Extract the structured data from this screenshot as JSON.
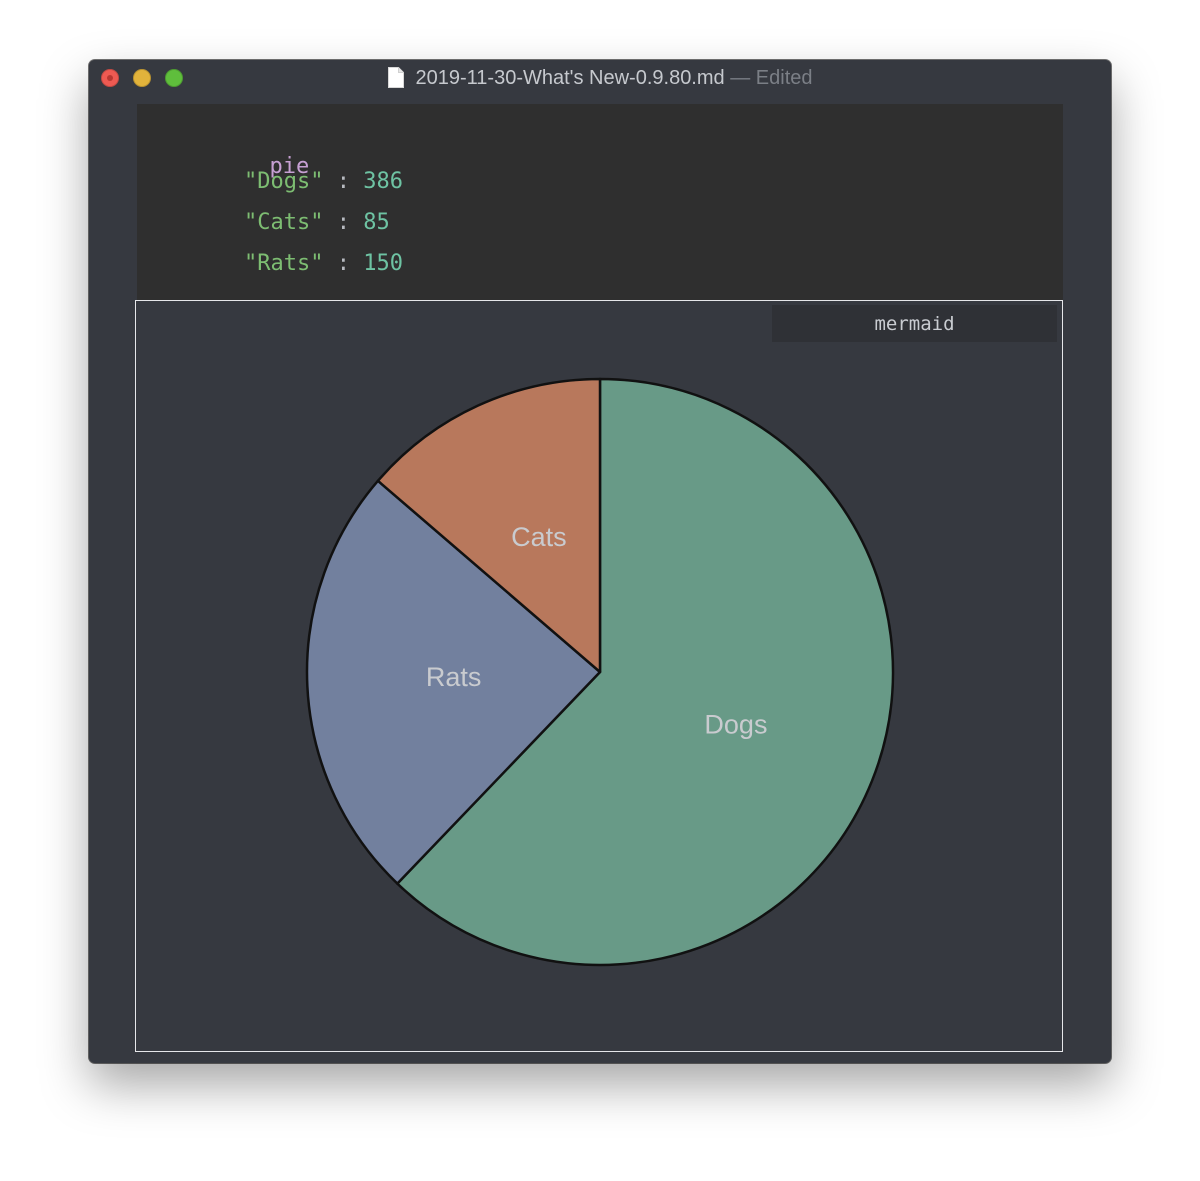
{
  "window": {
    "title": "2019-11-30-What's New-0.9.80.md",
    "separator": "—",
    "status": "Edited"
  },
  "code": {
    "keyword": "pie",
    "lines": [
      {
        "key": "\"Dogs\"",
        "sep": " : ",
        "value": "386"
      },
      {
        "key": "\"Cats\"",
        "sep": " : ",
        "value": "85"
      },
      {
        "key": "\"Rats\"",
        "sep": " : ",
        "value": "150"
      }
    ]
  },
  "diagram": {
    "language_label": "mermaid"
  },
  "chart_data": {
    "type": "pie",
    "start_angle_deg": 0,
    "direction": "clockwise",
    "slices": [
      {
        "label": "Dogs",
        "value": 386,
        "color": "#689a87"
      },
      {
        "label": "Rats",
        "value": 150,
        "color": "#72809e"
      },
      {
        "label": "Cats",
        "value": 85,
        "color": "#b8785c"
      }
    ],
    "stroke_color": "#111111"
  },
  "colors": {
    "window_bg": "#363940",
    "code_bg": "#2f2f2f",
    "traffic_close": "#ee5a52",
    "traffic_minimize": "#e2b33b",
    "traffic_zoom": "#5fbe3c"
  }
}
